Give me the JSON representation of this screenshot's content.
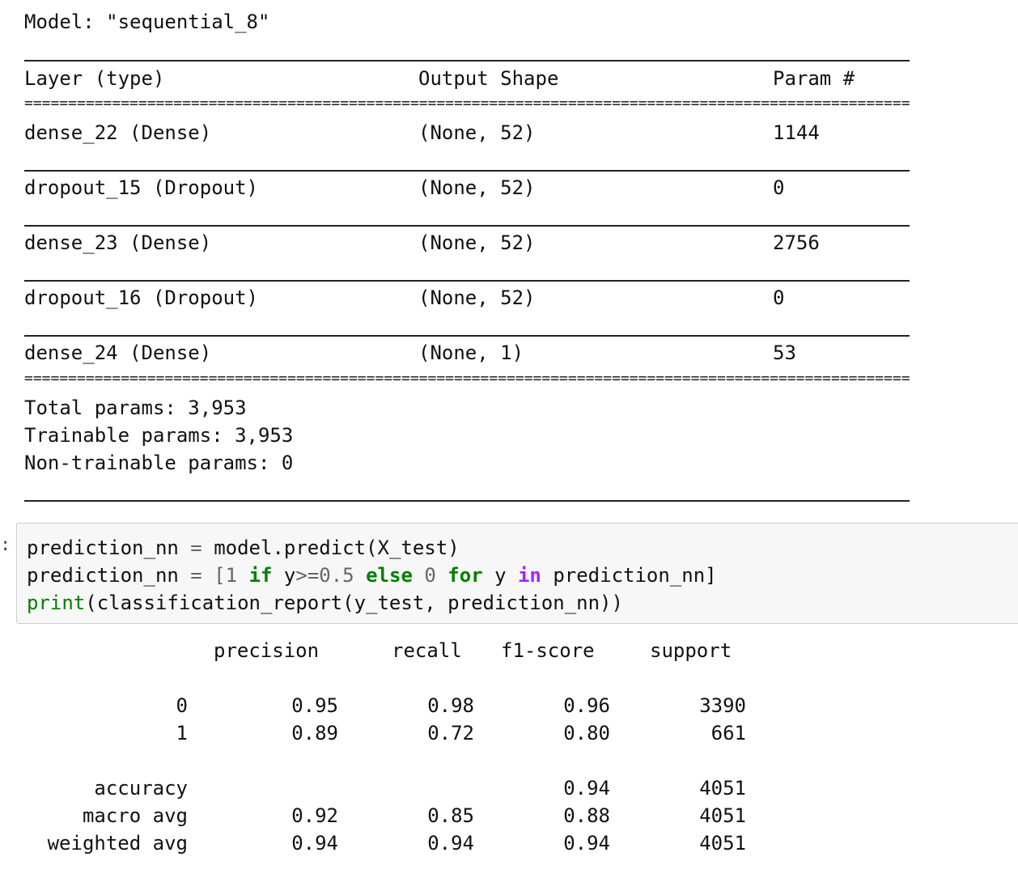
{
  "summary": {
    "model_line": "Model: \"sequential_8\"",
    "headers": {
      "layer": "Layer (type)",
      "shape": "Output Shape",
      "params": "Param #"
    },
    "rows": [
      {
        "layer": "dense_22 (Dense)",
        "shape": "(None, 52)",
        "params": "1144"
      },
      {
        "layer": "dropout_15 (Dropout)",
        "shape": "(None, 52)",
        "params": "0"
      },
      {
        "layer": "dense_23 (Dense)",
        "shape": "(None, 52)",
        "params": "2756"
      },
      {
        "layer": "dropout_16 (Dropout)",
        "shape": "(None, 52)",
        "params": "0"
      },
      {
        "layer": "dense_24 (Dense)",
        "shape": "(None, 1)",
        "params": "53"
      }
    ],
    "total": "Total params: 3,953",
    "trainable": "Trainable params: 3,953",
    "non_trainable": "Non-trainable params: 0"
  },
  "code": {
    "line1": {
      "a": "prediction_nn",
      "op": " = ",
      "b": "model.predict(X_test)"
    },
    "line2": {
      "a": "prediction_nn",
      "op": " = ",
      "open": "[",
      "n1": "1",
      "kw_if": "if",
      "cond": "y",
      "cmp": ">=",
      "n05": "0.5",
      "kw_else": "else",
      "n0": "0",
      "kw_for": "for",
      "var": "y",
      "kw_in": "in",
      "iter": "prediction_nn]"
    },
    "line3": {
      "fn": "print",
      "rest": "(classification_report(y_test, prediction_nn))"
    }
  },
  "report": {
    "headers": [
      "precision",
      "recall",
      "f1-score",
      "support"
    ],
    "rows": [
      {
        "label": "0",
        "precision": "0.95",
        "recall": "0.98",
        "f1": "0.96",
        "support": "3390"
      },
      {
        "label": "1",
        "precision": "0.89",
        "recall": "0.72",
        "f1": "0.80",
        "support": "661"
      }
    ],
    "accuracy": {
      "label": "accuracy",
      "f1": "0.94",
      "support": "4051"
    },
    "macro": {
      "label": "macro avg",
      "precision": "0.92",
      "recall": "0.85",
      "f1": "0.88",
      "support": "4051"
    },
    "weighted": {
      "label": "weighted avg",
      "precision": "0.94",
      "recall": "0.94",
      "f1": "0.94",
      "support": "4051"
    }
  }
}
